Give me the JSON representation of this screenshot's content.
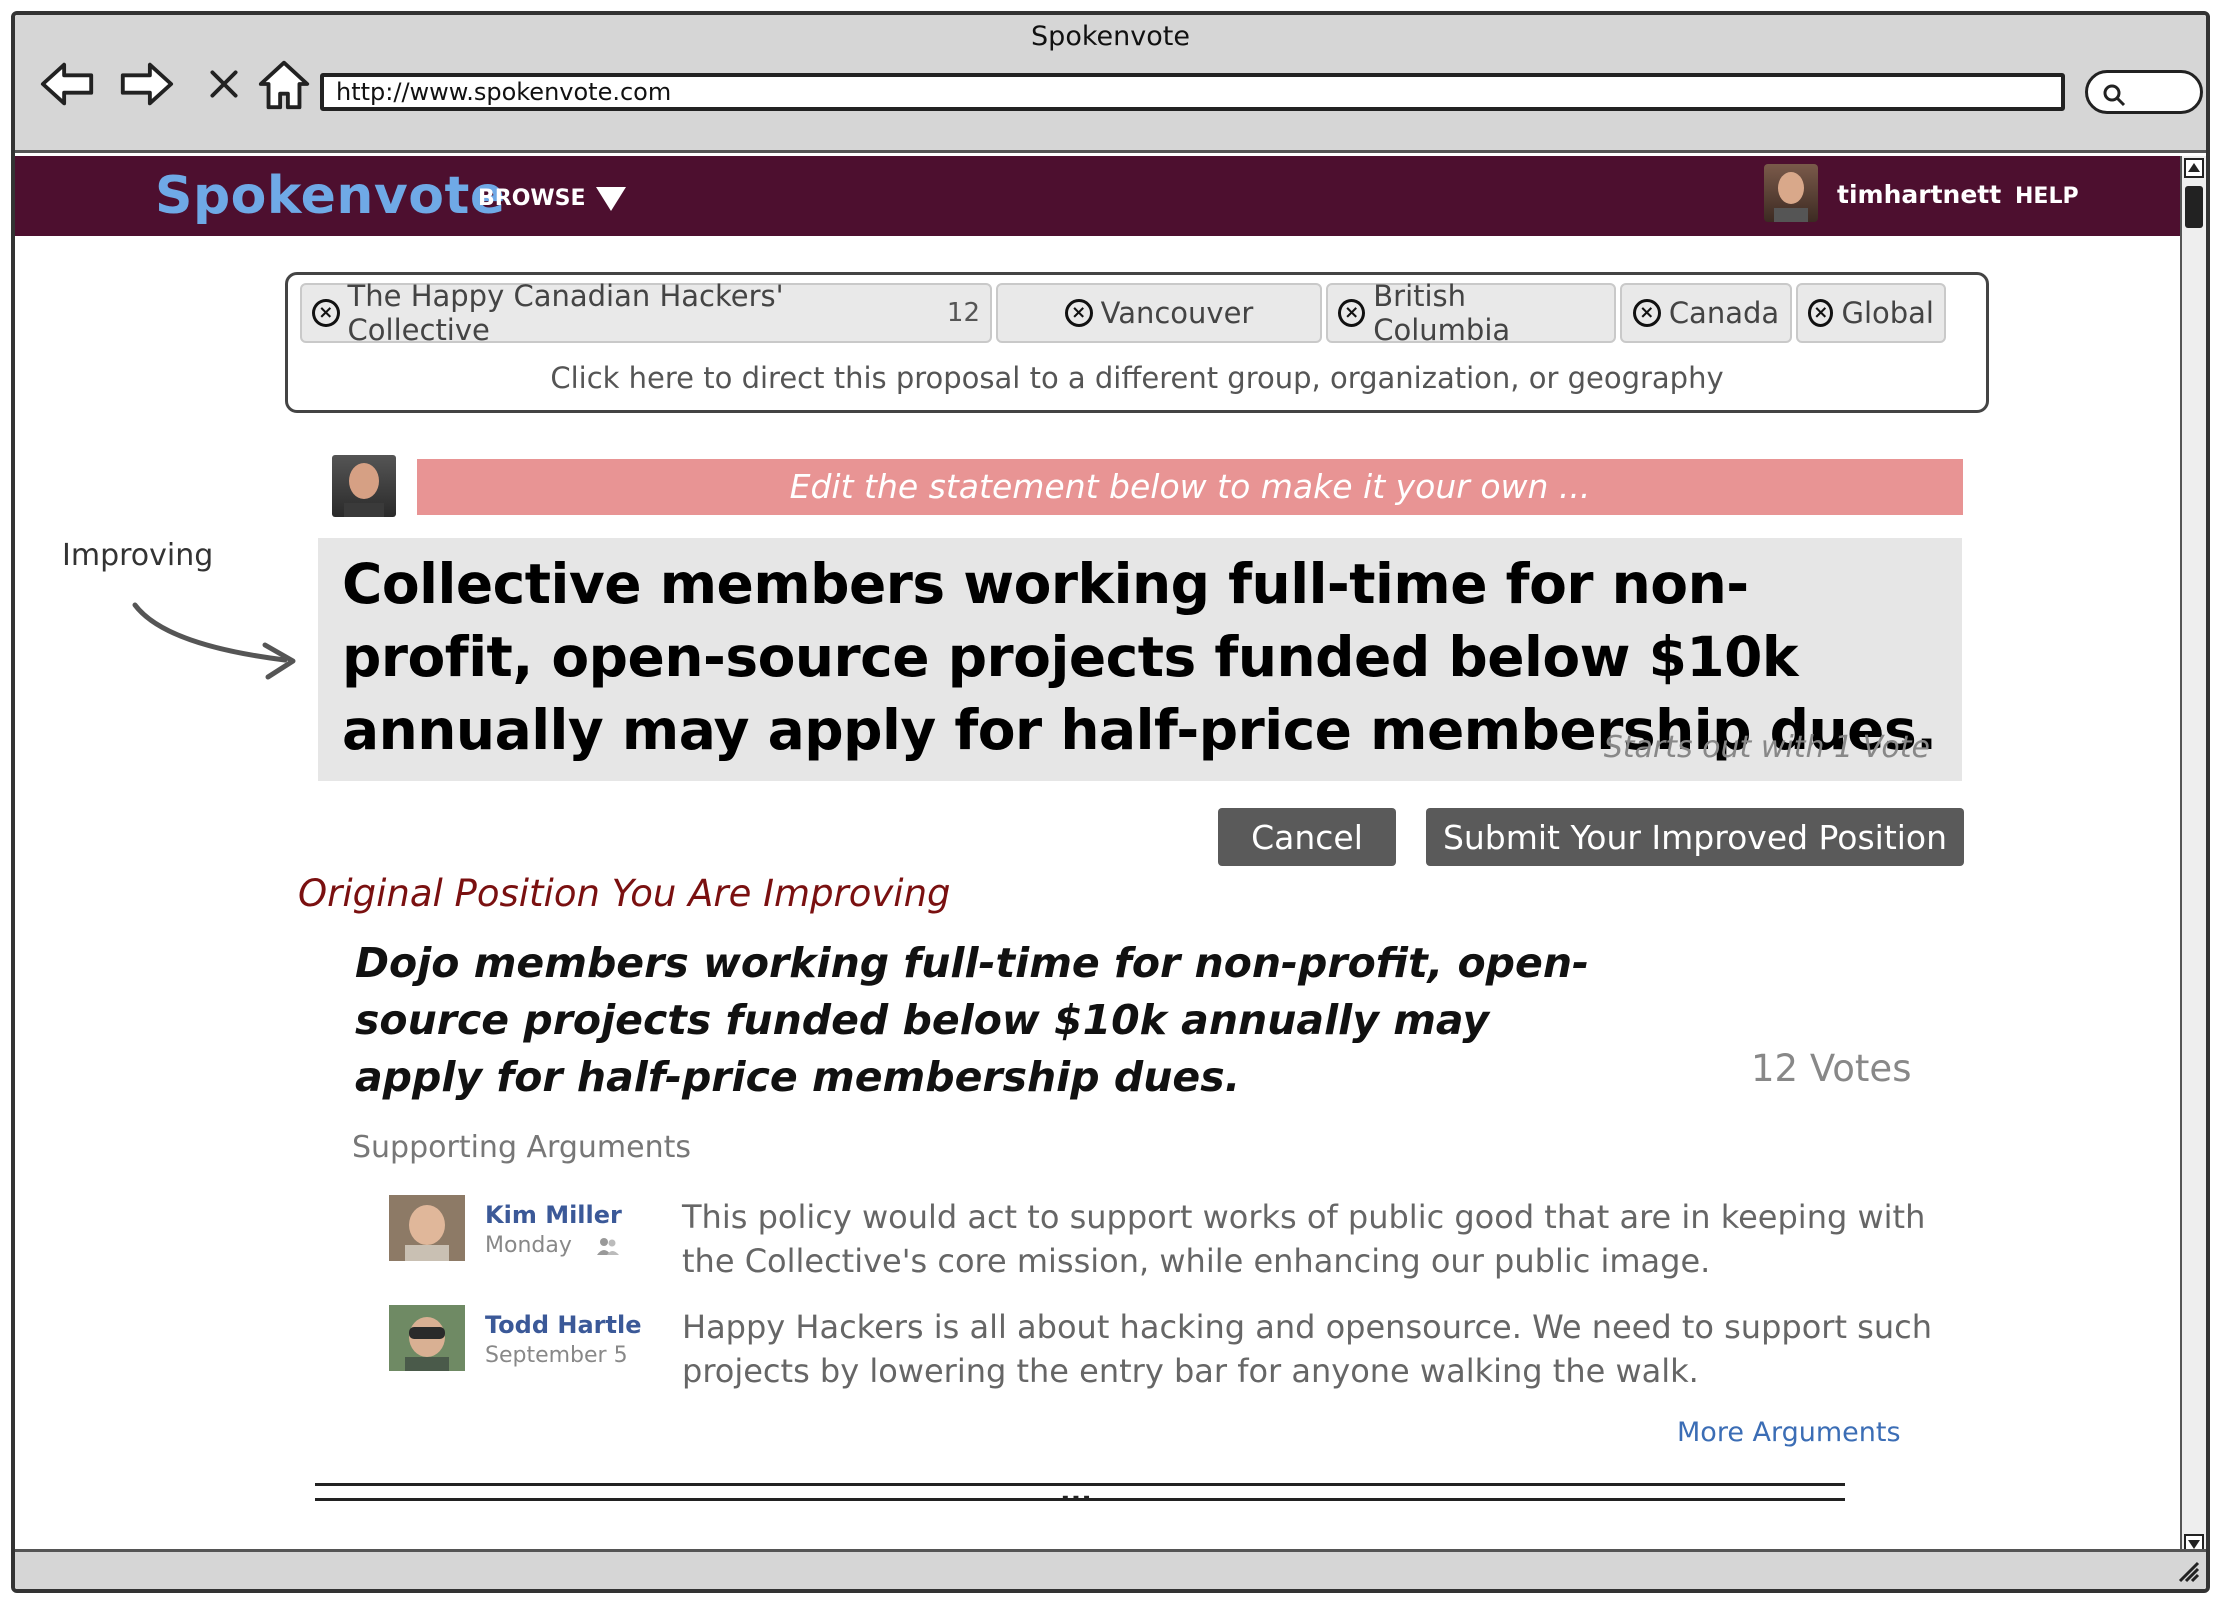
{
  "window": {
    "title": "Spokenvote",
    "url": "http://www.spokenvote.com"
  },
  "header": {
    "logo": "Spokenvote",
    "browse": "BROWSE",
    "username": "timhartnett",
    "help": "HELP",
    "colors": {
      "bar": "#4d0f2f",
      "logo": "#6fa9e6"
    }
  },
  "target": {
    "tags": [
      {
        "label": "The Happy Canadian Hackers' Collective",
        "count": "12"
      },
      {
        "label": "Vancouver"
      },
      {
        "label": "British Columbia"
      },
      {
        "label": "Canada"
      },
      {
        "label": "Global"
      }
    ],
    "hint": "Click here to direct this proposal to a different group, organization, or geography"
  },
  "editor": {
    "banner": "Edit the statement below to make it your own ...",
    "annotation": "Improving",
    "statement": "Collective members working full-time for non-profit, open-source projects funded below $10k annually may apply for half-price membership dues.",
    "starts_out": "Starts out with 1 Vote",
    "cancel_label": "Cancel",
    "submit_label": "Submit Your Improved Position"
  },
  "original": {
    "heading": "Original Position You Are Improving",
    "text": "Dojo members working full-time for non-profit, open-source projects funded below $10k annually may apply for half-price membership dues.",
    "votes": "12 Votes",
    "supporting_heading": "Supporting Arguments",
    "arguments": [
      {
        "author": "Kim Miller",
        "date": "Monday",
        "text": "This policy would act to support works of public good that are in keeping with the Collective's core mission, while enhancing our public image."
      },
      {
        "author": "Todd Hartle",
        "date": "September 5",
        "text": "Happy Hackers is all about hacking and opensource. We need to support such projects by lowering the entry bar for anyone walking the walk."
      }
    ],
    "more_label": "More Arguments",
    "ellipsis": "..."
  }
}
